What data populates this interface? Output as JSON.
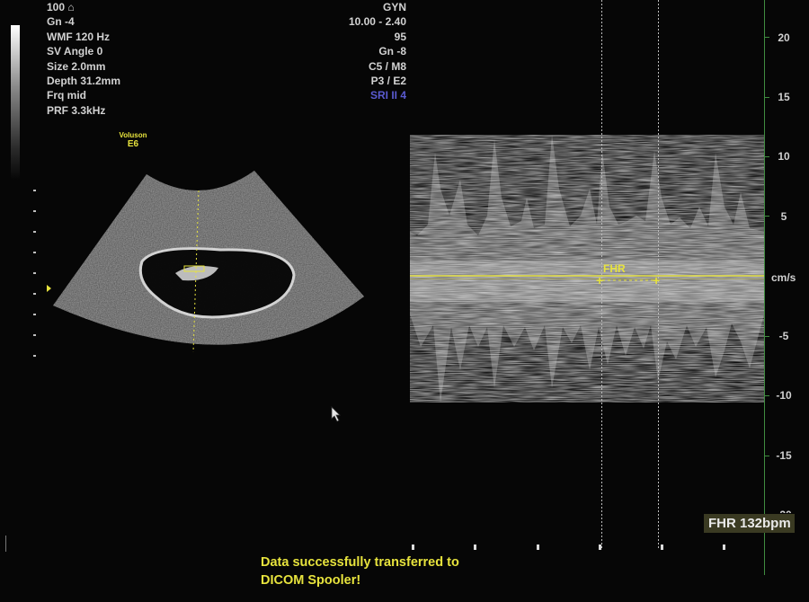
{
  "left_params": [
    "100 ⌂",
    "Gn  -4",
    "WMF 120 Hz",
    "SV Angle  0",
    "Size  2.0mm",
    "Depth 31.2mm",
    "Frq mid",
    "PRF  3.3kHz"
  ],
  "right_params": [
    "GYN",
    "10.00 - 2.40",
    "95",
    "Gn  -8",
    "C5 / M8",
    "P3 / E2",
    "SRI II 4"
  ],
  "brand": {
    "line1": "Voluson",
    "line2": "E6"
  },
  "doppler": {
    "scale_labels": [
      "20",
      "15",
      "10",
      "5",
      "cm/s",
      "-5",
      "-10",
      "-15",
      "-20"
    ],
    "unit": "cm/s",
    "caliper_label": "FHR"
  },
  "fhr_readout": "FHR 132bpm",
  "status_message": {
    "line1": "Data successfully transferred to",
    "line2": "DICOM Spooler!"
  },
  "colors": {
    "annotation": "#e7e33d",
    "scale": "#3f8c3f",
    "accent": "#5a5ad0"
  }
}
